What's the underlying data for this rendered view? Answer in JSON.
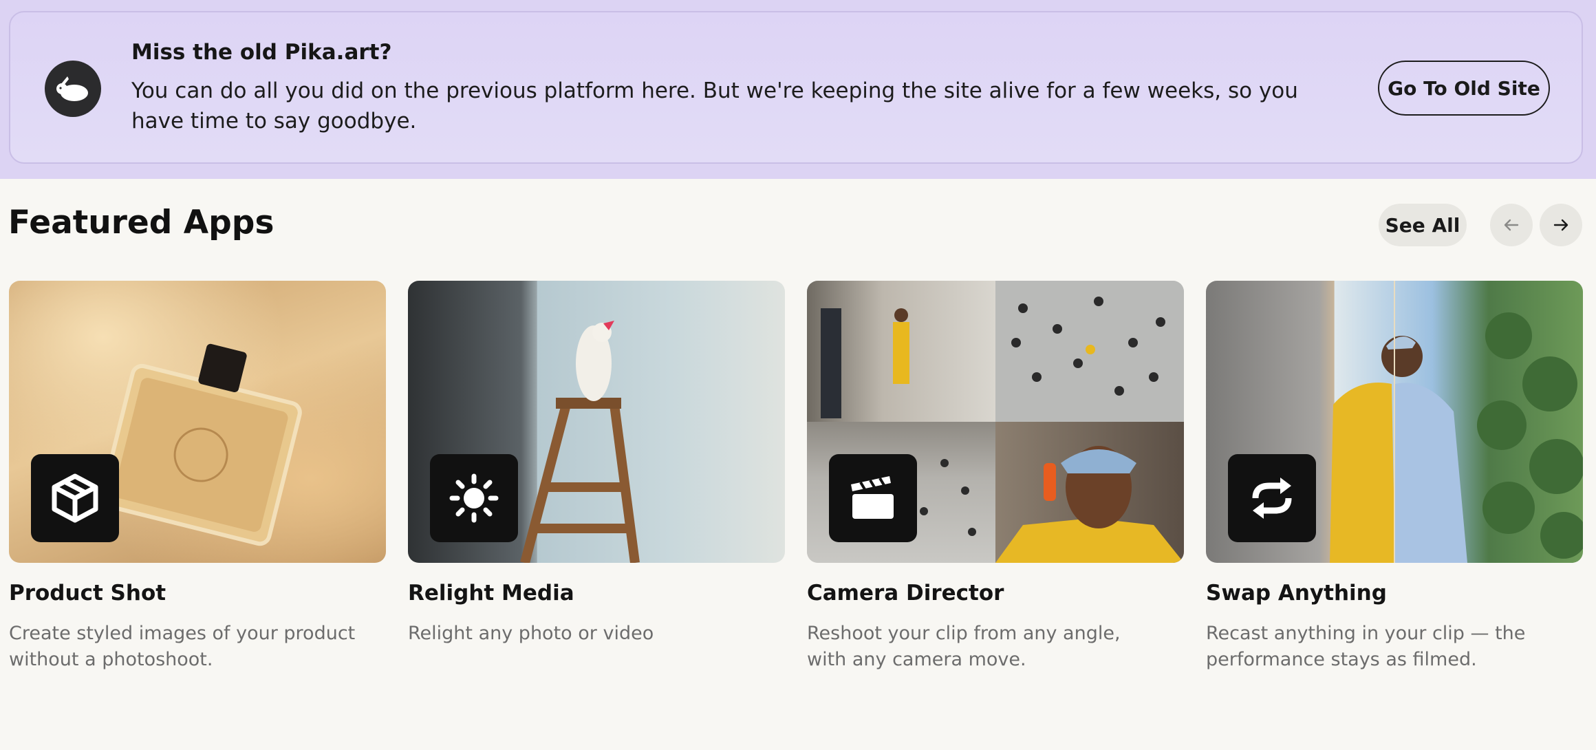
{
  "banner": {
    "title": "Miss the old Pika.art?",
    "text": "You can do all you did on the previous platform here. But we're keeping the site alive for a few weeks, so you have time to say goodbye.",
    "button_label": "Go To Old Site",
    "logo_icon": "pika-bunny-icon"
  },
  "featured": {
    "title": "Featured Apps",
    "see_all_label": "See All",
    "prev_icon": "arrow-left-icon",
    "next_icon": "arrow-right-icon",
    "apps": [
      {
        "title": "Product Shot",
        "description": "Create styled images of your product without a photoshoot.",
        "icon": "cube-icon"
      },
      {
        "title": "Relight Media",
        "description": "Relight any photo or video",
        "icon": "sun-icon"
      },
      {
        "title": "Camera Director",
        "description": "Reshoot your clip from any angle, with any camera move.",
        "icon": "clapperboard-icon"
      },
      {
        "title": "Swap Anything",
        "description": "Recast anything in your clip — the performance stays as filmed.",
        "icon": "swap-arrows-icon"
      }
    ]
  },
  "colors": {
    "banner_bg": "#ddd4f5",
    "page_bg": "#f8f7f3",
    "icon_tile": "#111111"
  }
}
